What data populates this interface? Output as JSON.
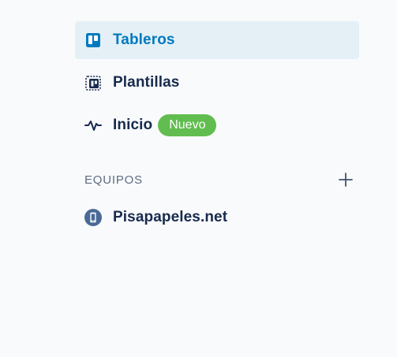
{
  "nav": {
    "items": [
      {
        "label": "Tableros",
        "icon": "board-icon",
        "active": true
      },
      {
        "label": "Plantillas",
        "icon": "template-icon",
        "active": false
      },
      {
        "label": "Inicio",
        "icon": "activity-icon",
        "active": false,
        "badge": "Nuevo"
      }
    ]
  },
  "teams": {
    "title": "EQUIPOS",
    "add_icon": "plus-icon",
    "items": [
      {
        "label": "Pisapapeles.net",
        "icon": "team-phone-icon"
      }
    ]
  },
  "colors": {
    "accent": "#0079bf",
    "active_bg": "#e4f0f6",
    "text": "#172b4d",
    "muted": "#5e6c84",
    "badge_bg": "#61bd4f",
    "page_bg": "#f9fafc"
  }
}
